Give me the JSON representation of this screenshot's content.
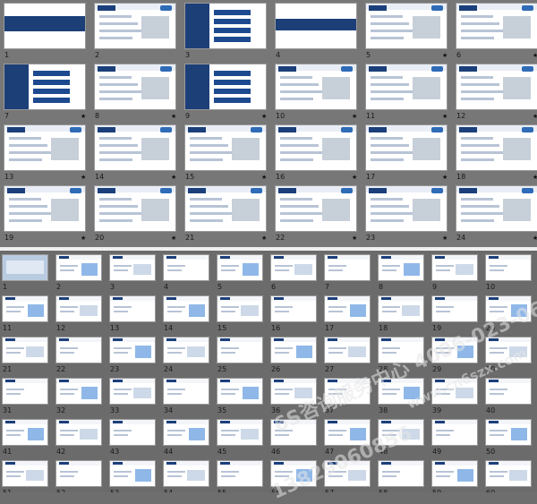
{
  "panel_a": {
    "numbers": [
      "1",
      "2",
      "3",
      "4",
      "5",
      "6",
      "7",
      "8",
      "9",
      "10",
      "11",
      "12",
      "13",
      "14",
      "15",
      "16",
      "17",
      "18",
      "19",
      "20",
      "21",
      "22",
      "23",
      "24"
    ],
    "slide_titles": {
      "s4": "目视化管理基本概念",
      "s3": "目录",
      "s9": "目视化管理标准"
    },
    "star_marks": [
      "5",
      "6",
      "7",
      "8",
      "9",
      "10",
      "11",
      "12",
      "13",
      "14",
      "15",
      "16",
      "17",
      "18",
      "19",
      "20",
      "21",
      "22",
      "23",
      "24"
    ],
    "star_glyph": "★"
  },
  "panel_b": {
    "numbers": [
      "1",
      "2",
      "3",
      "4",
      "5",
      "6",
      "7",
      "8",
      "9",
      "10",
      "11",
      "12",
      "13",
      "14",
      "15",
      "16",
      "17",
      "18",
      "19",
      "20",
      "21",
      "22",
      "23",
      "24",
      "25",
      "26",
      "27",
      "28",
      "29",
      "30",
      "31",
      "32",
      "33",
      "34",
      "35",
      "36",
      "37",
      "38",
      "39",
      "40",
      "41",
      "42",
      "43",
      "44",
      "45",
      "46",
      "47",
      "48",
      "49",
      "50",
      "51",
      "52",
      "53",
      "54",
      "55",
      "56",
      "57",
      "58",
      "59",
      "60"
    ]
  },
  "watermark": {
    "line1": "6S咨询服务中心 4006-023-060",
    "line2": "www.cn6szx.com",
    "line3": "13829060856"
  },
  "colors": {
    "navy": "#1c3f78",
    "accent_blue": "#2f6bb7"
  }
}
